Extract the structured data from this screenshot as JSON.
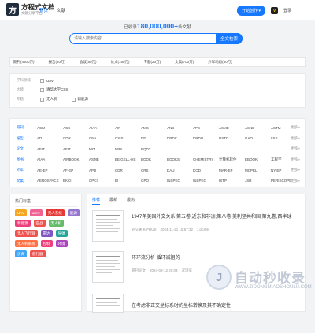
{
  "header": {
    "logo_mark": "方",
    "logo_name": "方程式文档",
    "logo_sub": "文献分享平台",
    "nav": [
      "首页",
      "文献"
    ],
    "join_label": "开始创作",
    "vip_icon": "V",
    "login_label": "登录"
  },
  "hero": {
    "count_prefix": "已收录",
    "count": "180,000,000+",
    "count_suffix": "条文献",
    "search_placeholder": "请输入搜索内容",
    "search_button": "全文检索"
  },
  "categories": [
    "期刊(4500万)",
    "报告(20万)",
    "会议(80万)",
    "论文(150万)",
    "专题(20万)",
    "文集(700万)",
    "外军动态(50万)"
  ],
  "filters": [
    {
      "label": "学科领域",
      "value": "UAV",
      "icon": "box-icon"
    },
    {
      "label": "大能",
      "value": "清华大学CSS",
      "icon": "box-icon"
    },
    {
      "label": "专题",
      "values": [
        "无人机",
        "新能源"
      ],
      "icon": "box-icon"
    }
  ],
  "databases": [
    {
      "label": "期刊",
      "items": [
        "ACM",
        "ACS",
        "AIAA",
        "AIP",
        "AMS",
        "ANS",
        "APS",
        "ASME",
        "ASNE",
        "ASTM"
      ],
      "more": "更多»"
    },
    {
      "label": "报告",
      "items": [
        "AD",
        "CDR",
        "CNA",
        "CSIS",
        "DE",
        "DRDC",
        "DRDO",
        "DSTO",
        "GAO",
        "IISS"
      ],
      "more": "更多»"
    },
    {
      "label": "论文",
      "items": [
        "AFIT",
        "AFIT",
        "MIT",
        "NPS",
        "PQDT"
      ],
      "more": "更多»"
    },
    {
      "label": "图书",
      "items": [
        "AIAA",
        "AIRBOOK",
        "ASME",
        "BEIGELL-HS",
        "BOOK",
        "BOOKS",
        "CHEMISTRY",
        "计算机软件",
        "EBOOK",
        "工程学"
      ],
      "more": "更多»"
    },
    {
      "label": "外军",
      "items": [
        "AE-EP",
        "AF-EP",
        "APD",
        "CDR",
        "CRS",
        "DAU",
        "DOD",
        "MAR-EP",
        "MCPEL",
        "NY-EP"
      ],
      "more": "更多»"
    },
    {
      "label": "文集",
      "items": [
        "AEROSPACE",
        "BKCI",
        "CPCI",
        "EI",
        "GPO",
        "INSPEC",
        "INSPEC",
        "ISTP",
        "JSR",
        "PERISCOPE"
      ],
      "more": "更多»"
    }
  ],
  "hot": {
    "title": "热门标签",
    "tags": [
      {
        "label": "UAV",
        "color": "#f5a623"
      },
      {
        "label": "army",
        "color": "#f06292"
      },
      {
        "label": "无人系统",
        "color": "#e53935"
      },
      {
        "label": "能源",
        "color": "#9575cd"
      },
      {
        "label": "新能源",
        "color": "#ec407a"
      },
      {
        "label": "空战",
        "color": "#ef5350"
      },
      {
        "label": "无人机",
        "color": "#66bb6a"
      },
      {
        "label": "无人飞行器",
        "color": "#ef5350"
      },
      {
        "label": "雷达",
        "color": "#7e57c2"
      },
      {
        "label": "导弹",
        "color": "#26a69a"
      },
      {
        "label": "无人机系统",
        "color": "#ff7043"
      },
      {
        "label": "控制",
        "color": "#ec407a"
      },
      {
        "label": "环境",
        "color": "#ab47bc"
      },
      {
        "label": "仿真",
        "color": "#42a5f5"
      },
      {
        "label": "航行器",
        "color": "#ef5350"
      }
    ]
  },
  "feed": {
    "tabs": [
      "推荐",
      "最新",
      "最热"
    ],
    "docs": [
      {
        "title": "1947年美国外交关系:第五卷,近东和非洲;第八卷,美利坚共和国;第九卷,西半球",
        "source": "外交关系 FRUS",
        "date": "2024-11-21 15:57:32",
        "views": "1次浏览"
      },
      {
        "title": "环环流分析 循环减阻的",
        "source": "期刊论文",
        "date": "2024-08-12 20:03",
        "views": "次浏览"
      },
      {
        "title": "在考虑非正交坐标系时的坐标转换及其不确定性",
        "source": "",
        "date": "",
        "views": ""
      }
    ]
  },
  "watermark": {
    "mark": "J",
    "text": "自动秒收录",
    "url": "WWW.ZIDONGMIAOSHOULU.COM"
  }
}
